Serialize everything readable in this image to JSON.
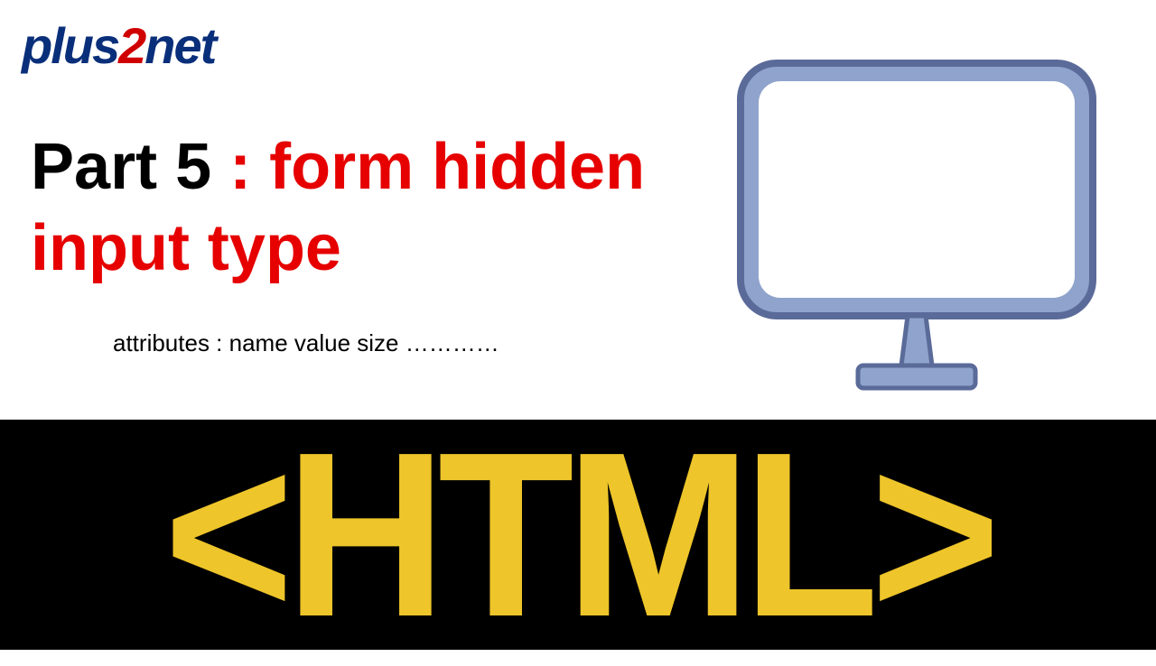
{
  "logo": {
    "part1": "plus",
    "part2": "2",
    "part3": "net"
  },
  "title": {
    "prefix": "Part 5 ",
    "rest": ": form hidden  input type"
  },
  "subtitle": "attributes : name value size …………",
  "banner": "<HTML>"
}
